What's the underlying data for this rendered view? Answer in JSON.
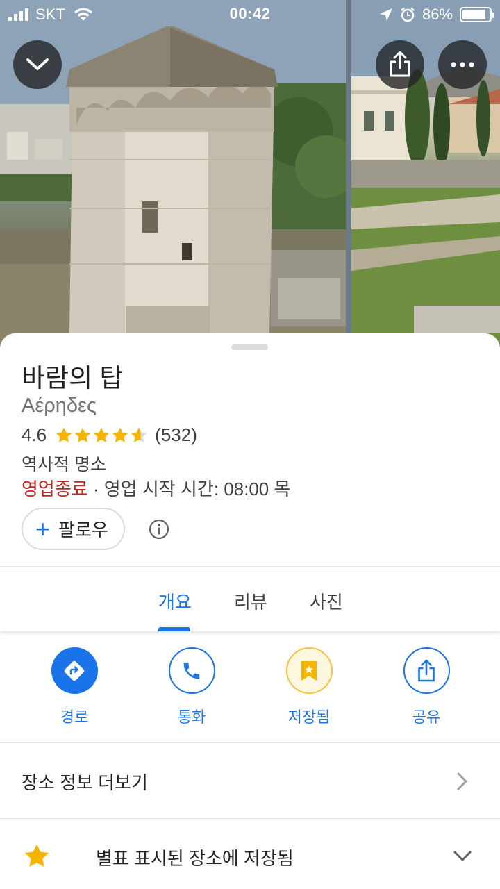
{
  "status_bar": {
    "carrier": "SKT",
    "time": "00:42",
    "battery_percent": "86%",
    "battery_level": 0.86,
    "icons": [
      "signal-icon",
      "wifi-icon",
      "location-arrow-icon",
      "alarm-icon",
      "battery-icon"
    ]
  },
  "header": {
    "back_icon": "chevron-down-icon",
    "share_icon": "share-icon",
    "more_icon": "more-horizontal-icon"
  },
  "place": {
    "title": "바람의 탑",
    "subtitle": "Αέρηδες",
    "rating": "4.6",
    "rating_stars": 4.6,
    "review_count": "(532)",
    "category": "역사적 명소",
    "status_closed": "영업종료",
    "status_rest": " · 영업 시작 시간: 08:00 목",
    "follow_label": "팔로우"
  },
  "tabs": [
    {
      "label": "개요",
      "active": true
    },
    {
      "label": "리뷰",
      "active": false
    },
    {
      "label": "사진",
      "active": false
    }
  ],
  "actions": [
    {
      "label": "경로",
      "icon": "directions-icon"
    },
    {
      "label": "통화",
      "icon": "phone-icon"
    },
    {
      "label": "저장됨",
      "icon": "bookmark-star-icon"
    },
    {
      "label": "공유",
      "icon": "share-icon"
    }
  ],
  "more_info": {
    "label": "장소 정보 더보기"
  },
  "saved_list": {
    "label": "별표 표시된 장소에 저장됨"
  },
  "colors": {
    "accent": "#1a73e8",
    "closed": "#c5221f",
    "star": "#f4b400",
    "saved_bg": "#fef7e0"
  }
}
